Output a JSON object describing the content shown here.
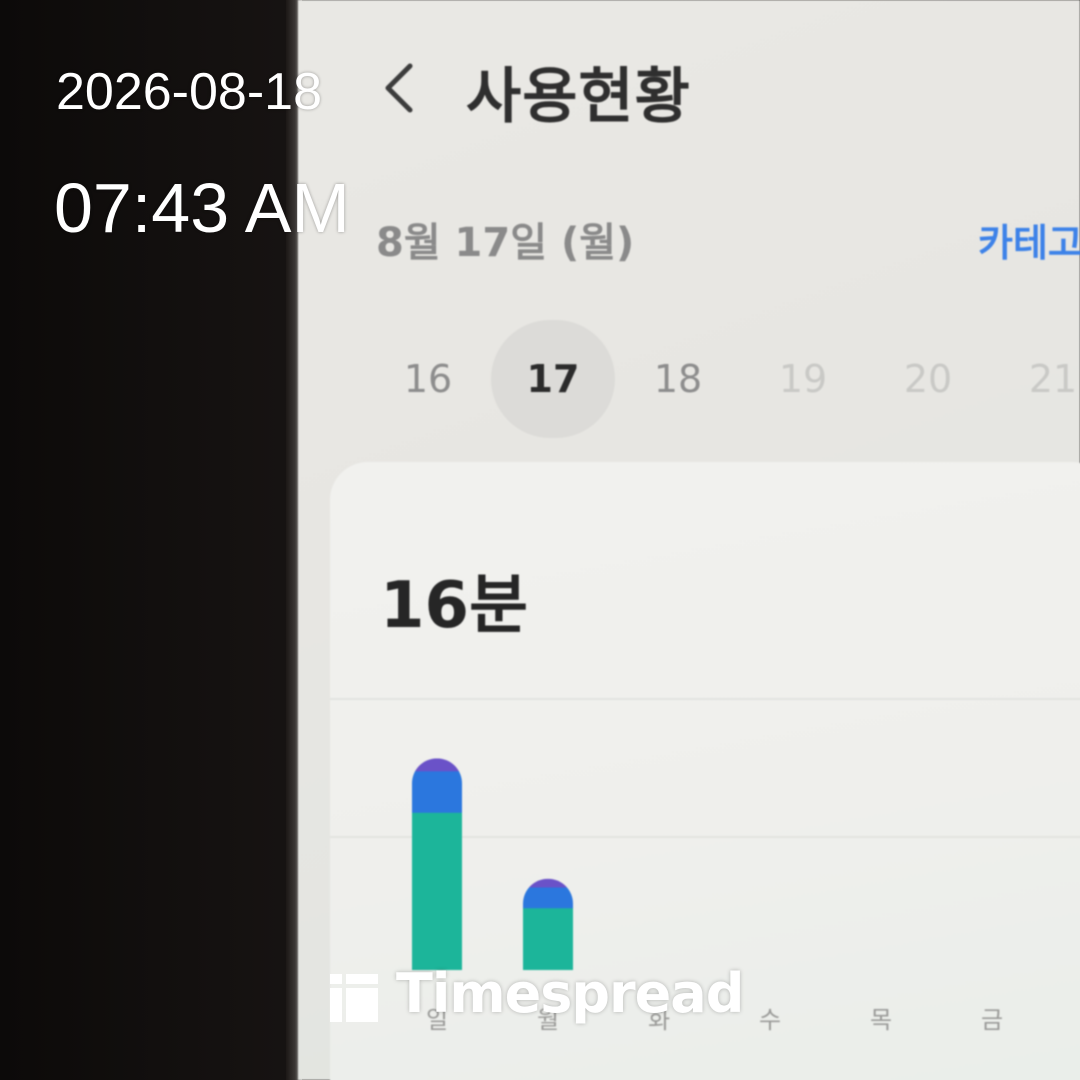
{
  "overlay": {
    "date": "2026-08-18",
    "time": "07:43 AM",
    "watermark": "Timespread"
  },
  "app": {
    "title": "사용현황",
    "selected_date": "8월 17일 (월)",
    "category_link": "카테고",
    "days": [
      {
        "label": "16",
        "state": "past"
      },
      {
        "label": "17",
        "state": "selected"
      },
      {
        "label": "18",
        "state": "past"
      },
      {
        "label": "19",
        "state": "future"
      },
      {
        "label": "20",
        "state": "future"
      },
      {
        "label": "21",
        "state": "future"
      }
    ],
    "total_usage": "16분"
  },
  "colors": {
    "accent": "#3d82e8",
    "bar_teal": "#1cb59a",
    "bar_blue": "#2b77de",
    "bar_purple": "#6a52c8"
  },
  "chart_data": {
    "type": "bar",
    "stacked": true,
    "categories": [
      "일",
      "월",
      "화",
      "수",
      "목",
      "금"
    ],
    "series": [
      {
        "color": "#1cb59a",
        "values": [
          19,
          7.5,
          0,
          0,
          0,
          0
        ]
      },
      {
        "color": "#2b77de",
        "values": [
          5,
          2.5,
          0,
          0,
          0,
          0
        ]
      },
      {
        "color": "#6a52c8",
        "values": [
          1.5,
          1,
          0,
          0,
          0,
          0
        ]
      }
    ],
    "gridlines": true,
    "legend": "none"
  }
}
